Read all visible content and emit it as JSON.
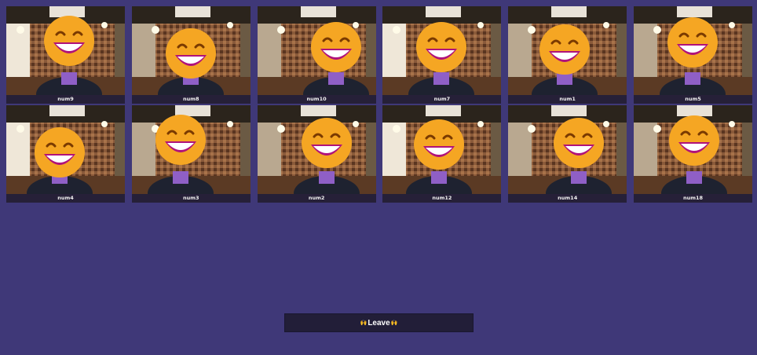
{
  "participants": [
    {
      "name": "num9"
    },
    {
      "name": "num8"
    },
    {
      "name": "num10"
    },
    {
      "name": "num7"
    },
    {
      "name": "num1"
    },
    {
      "name": "num5"
    },
    {
      "name": "num4"
    },
    {
      "name": "num3"
    },
    {
      "name": "num2"
    },
    {
      "name": "num12"
    },
    {
      "name": "num14"
    },
    {
      "name": "num18"
    }
  ],
  "leave_button": {
    "label": "Leave",
    "icon": "raised-hands-emoji"
  },
  "colors": {
    "background": "#3f3878",
    "name_bar": "#262038",
    "emoji": "#f5a623"
  }
}
